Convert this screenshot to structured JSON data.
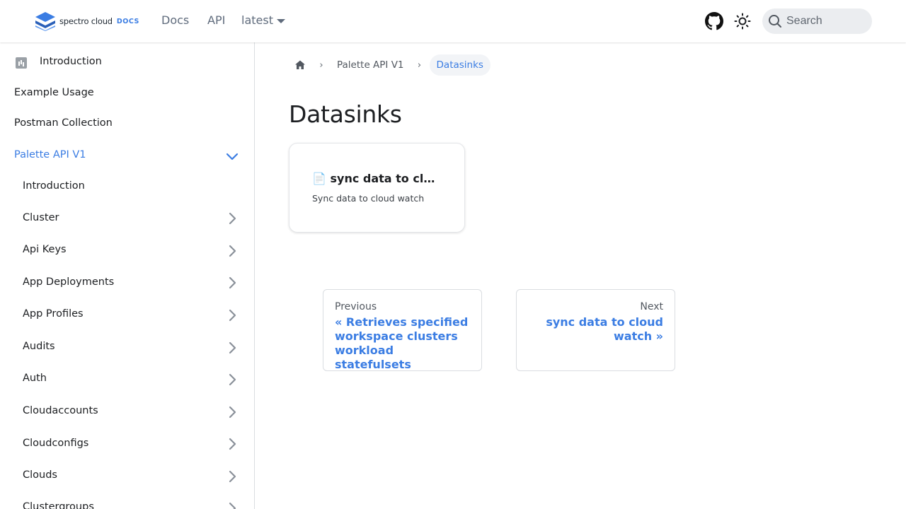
{
  "navbar": {
    "logo_text": "spectro cloud",
    "logo_docs": "DOCS",
    "links": {
      "docs": "Docs",
      "api": "API",
      "version": "latest"
    },
    "search_placeholder": "Search",
    "icons": [
      "github-icon",
      "theme-toggle-icon",
      "search-icon",
      "chevron-down-icon"
    ]
  },
  "sidebar": {
    "items": [
      {
        "label": "Introduction"
      },
      {
        "label": "Example Usage"
      },
      {
        "label": "Postman Collection"
      },
      {
        "label": "Palette API V1"
      },
      {
        "label": "Introduction"
      },
      {
        "label": "Cluster"
      },
      {
        "label": "Api Keys"
      },
      {
        "label": "App Deployments"
      },
      {
        "label": "App Profiles"
      },
      {
        "label": "Audits"
      },
      {
        "label": "Auth"
      },
      {
        "label": "Cloudaccounts"
      },
      {
        "label": "Cloudconfigs"
      },
      {
        "label": "Clouds"
      },
      {
        "label": "Clustergroups"
      }
    ]
  },
  "breadcrumb": {
    "items": [
      "Palette API V1"
    ],
    "active": "Datasinks"
  },
  "main": {
    "title": "Datasinks",
    "card": {
      "icon": "📄",
      "title": "📄 sync data to cloud watch",
      "description": "Sync data to cloud watch"
    },
    "pagination": {
      "prev_sub": "Previous",
      "prev_label": "« Retrieves specified workspace clusters workload statefulsets",
      "next_sub": "Next",
      "next_label": "sync data to cloud watch »"
    }
  },
  "colors": {
    "accent": "#3b7de3",
    "text": "#1c1e21",
    "muted": "#525860",
    "border": "#dadde1"
  }
}
